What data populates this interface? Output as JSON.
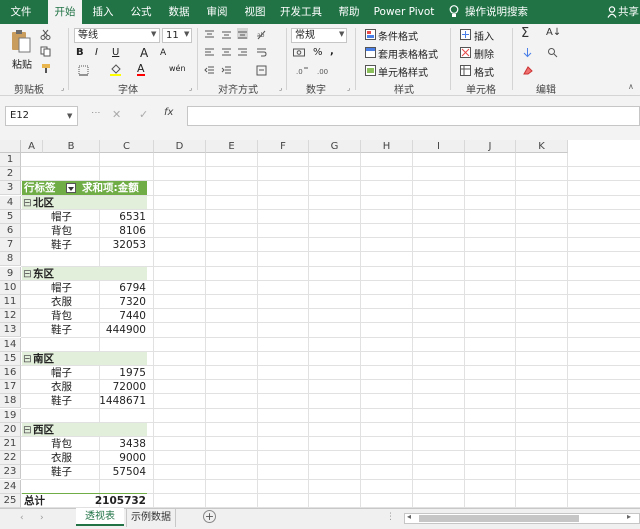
{
  "ribbon_tabs": [
    "文件",
    "开始",
    "插入",
    "公式",
    "数据",
    "审阅",
    "视图",
    "开发工具",
    "帮助",
    "Power Pivot",
    "操作说明搜索"
  ],
  "share_label": "共享",
  "clipboard": {
    "paste": "粘贴",
    "group": "剪贴板"
  },
  "font": {
    "name": "等线",
    "size": "11",
    "bold": "B",
    "italic": "I",
    "underline": "U",
    "grow": "A",
    "shrink": "A",
    "color_letter": "A",
    "phonetic": "wén",
    "group": "字体"
  },
  "alignment": {
    "group": "对齐方式"
  },
  "number": {
    "format": "常规",
    "percent": "%",
    "comma": ",",
    "group": "数字"
  },
  "styles": {
    "conditional": "条件格式",
    "table": "套用表格格式",
    "cell": "单元格样式",
    "group": "样式"
  },
  "cells": {
    "insert": "插入",
    "delete": "删除",
    "format": "格式",
    "group": "单元格"
  },
  "editing": {
    "group": "编辑"
  },
  "formula_bar": {
    "name_box": "E12",
    "fx": "fx",
    "formula": ""
  },
  "columns": [
    "A",
    "B",
    "C",
    "D",
    "E",
    "F",
    "G",
    "H",
    "I",
    "J",
    "K"
  ],
  "rows": [
    "1",
    "2",
    "3",
    "4",
    "5",
    "6",
    "7",
    "8",
    "9",
    "10",
    "11",
    "12",
    "13",
    "14",
    "15",
    "16",
    "17",
    "18",
    "19",
    "20",
    "21",
    "22",
    "23",
    "24",
    "25"
  ],
  "pivot": {
    "header_a": "行标签",
    "header_b": "求和项:金额",
    "collapse": "⊟",
    "regions": [
      {
        "name": "北区",
        "items": [
          {
            "label": "帽子",
            "value": "6531"
          },
          {
            "label": "背包",
            "value": "8106"
          },
          {
            "label": "鞋子",
            "value": "32053"
          }
        ]
      },
      {
        "name": "东区",
        "items": [
          {
            "label": "帽子",
            "value": "6794"
          },
          {
            "label": "衣服",
            "value": "7320"
          },
          {
            "label": "背包",
            "value": "7440"
          },
          {
            "label": "鞋子",
            "value": "444900"
          }
        ]
      },
      {
        "name": "南区",
        "items": [
          {
            "label": "帽子",
            "value": "1975"
          },
          {
            "label": "衣服",
            "value": "72000"
          },
          {
            "label": "鞋子",
            "value": "1448671"
          }
        ]
      },
      {
        "name": "西区",
        "items": [
          {
            "label": "背包",
            "value": "3438"
          },
          {
            "label": "衣服",
            "value": "9000"
          },
          {
            "label": "鞋子",
            "value": "57504"
          }
        ]
      }
    ],
    "total_label": "总计",
    "total_value": "2105732"
  },
  "sheets": [
    "透视表",
    "示例数据"
  ],
  "colors": {
    "excel_green": "#217346",
    "pivot_header": "#70ad47",
    "pivot_band": "#e2efda"
  }
}
